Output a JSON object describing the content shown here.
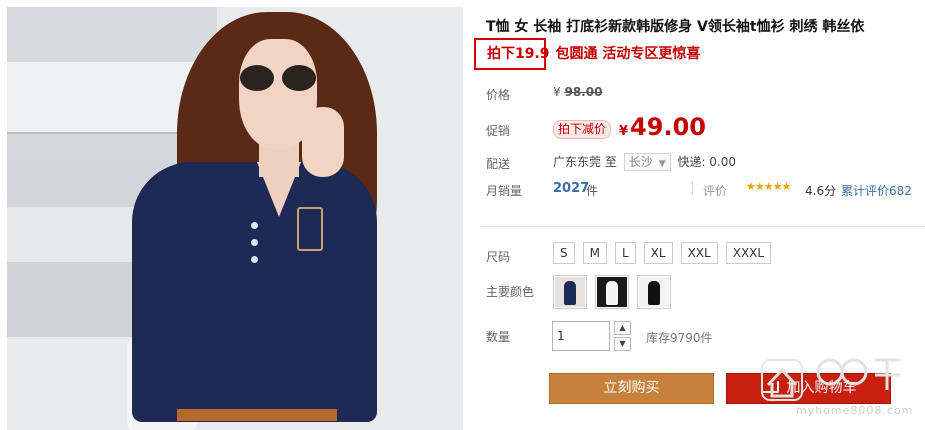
{
  "product": {
    "title": "T恤 女 长袖 打底衫新款韩版修身 V领长袖t恤衫 刺绣 韩丝依",
    "promo_highlight": "拍下19.9",
    "promo_rest": "包圆通 活动专区更惊喜",
    "main_image_alt": "woman in navy long-sleeve v-neck t-shirt"
  },
  "price": {
    "label": "价格",
    "currency": "¥",
    "original": "98.00"
  },
  "promotion": {
    "label": "促销",
    "tag": "拍下减价",
    "currency": "¥",
    "price": "49.00"
  },
  "delivery": {
    "label": "配送",
    "from": "广东东莞",
    "to_word": "至",
    "destination": "长沙",
    "express": "快递: 0.00"
  },
  "sales": {
    "label": "月销量",
    "count": "2027",
    "unit": "件",
    "rating_label": "评价",
    "stars": "★★★★★",
    "score": "4.6分",
    "reviews": "累计评价682"
  },
  "options": {
    "size_label": "尺码",
    "sizes": [
      "S",
      "M",
      "L",
      "XL",
      "XXL",
      "XXXL"
    ],
    "color_label": "主要颜色",
    "colors": [
      "navy",
      "white",
      "black"
    ]
  },
  "quantity": {
    "label": "数量",
    "value": "1",
    "stock": "库存9790件"
  },
  "actions": {
    "buy": "立刻购买",
    "cart": "加入购物车"
  },
  "watermark": {
    "text": "myhome8008.com"
  },
  "colors": {
    "price_red": "#c40000",
    "buy_orange": "#c6823c",
    "cart_red": "#c7200f",
    "link_blue": "#3a6ea5"
  }
}
